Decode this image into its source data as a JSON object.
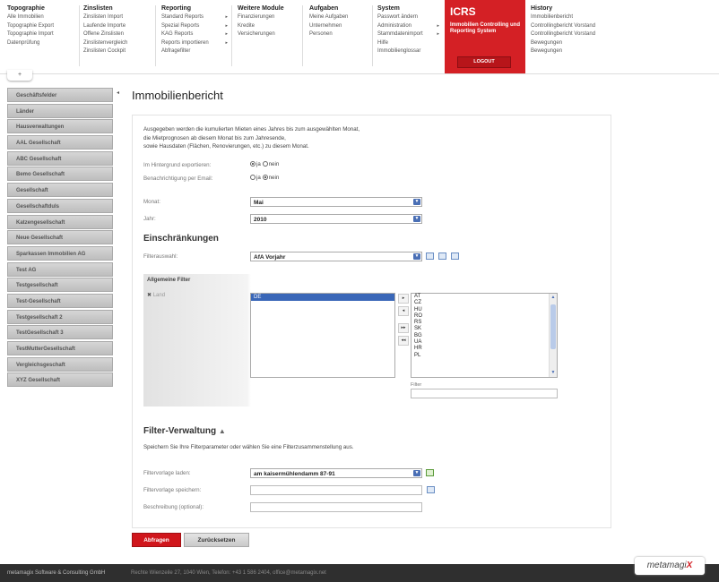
{
  "menu": [
    {
      "title": "Topographie",
      "items": [
        "Alle Immobilien",
        "Topographie Export",
        "Topographie Import",
        "Datenprüfung"
      ]
    },
    {
      "title": "Zinslisten",
      "items": [
        "Zinslisten Import",
        "Laufende Importe",
        "Offene Zinslisten",
        "Zinslistenvergleich",
        "Zinslisten Cockpit"
      ]
    },
    {
      "title": "Reporting",
      "items": [
        "Standard Reports",
        "Spezial Reports",
        "KAG Reports",
        "Reports importieren",
        "Abfragefilter"
      ]
    },
    {
      "title": "Weitere Module",
      "items": [
        "Finanzierungen",
        "Kredite",
        "Versicherungen"
      ]
    },
    {
      "title": "Aufgaben",
      "items": [
        "Meine Aufgaben",
        "Unternehmen",
        "Personen"
      ]
    },
    {
      "title": "System",
      "items": [
        "Passwort ändern",
        "Administration",
        "Stammdatenimport",
        "Hilfe",
        "Immobilienglossar"
      ]
    },
    {
      "title": "History",
      "items": [
        "Immobilienbericht",
        "Controllingbericht Vorstand",
        "Controllingbericht Vorstand",
        "Bewegungen",
        "Bewegungen"
      ]
    }
  ],
  "icrs": {
    "title": "ICRS",
    "subtitle": "Immobilien Controlling und Reporting System",
    "logout": "LOGOUT"
  },
  "toggle": "+",
  "sidebar": [
    "Geschäftsfelder",
    "Länder",
    "Hausverwaltungen",
    "AAL Gesellschaft",
    "ABC Gesellschaft",
    "Bemo Gesellschaft",
    "Gesellschaft",
    "Gesellschaftduls",
    "Katzengesellschaft",
    "Neue Gesellschaft",
    "Sparkassen Immobilien AG",
    "Test AG",
    "Testgesellschaft",
    "Test-Gesellschaft",
    "Testgesellschaft 2",
    "TestGesellschaft 3",
    "TestMutterGesellschaft",
    "Vergleichsgeschaft",
    "XYZ Gesellschaft"
  ],
  "page": {
    "title": "Immobilienbericht",
    "intro": [
      "Ausgegeben werden die kumulierten Mieten eines Jahres bis zum ausgewählten Monat,",
      "die Mietprognosen ab diesem Monat bis zum Jahresende,",
      "sowie Hausdaten (Flächen, Renovierungen, etc.) zu diesem Monat."
    ],
    "export_label": "Im Hintergrund exportieren:",
    "notify_label": "Benachrichtigung per Email:",
    "ja": "ja",
    "nein": "nein",
    "monat_label": "Monat:",
    "monat_value": "Mai",
    "jahr_label": "Jahr:",
    "jahr_value": "2010",
    "einschraenkungen": "Einschränkungen",
    "filterauswahl_label": "Filterauswahl:",
    "filterauswahl_value": "AfA Vorjahr",
    "allg_filter": "Allgemeine Filter",
    "land_label": "Land",
    "selected": [
      "DE"
    ],
    "available": [
      "AT",
      "CZ",
      "HU",
      "RO",
      "RS",
      "SK",
      "BG",
      "UA",
      "HR",
      "PL"
    ],
    "filter_label": "Filter",
    "filterverwaltung": "Filter-Verwaltung",
    "fv_text": "Speichern Sie Ihre Filterparameter oder wählen Sie eine Filterzusammenstellung aus.",
    "fv_laden_label": "Filtervorlage laden:",
    "fv_laden_value": "am kaisermühlendamm 87-91",
    "fv_speichern_label": "Filtervorlage speichern:",
    "beschreibung_label": "Beschreibung (optional):",
    "btn_abfragen": "Abfragen",
    "btn_reset": "Zurücksetzen"
  },
  "footer": {
    "company": "metamagix Software & Consulting GmbH",
    "address": "Rechte Wienzeile 27, 1040 Wien, Telefon: +43 1 586 2404, office@metamagix.net"
  },
  "logo": {
    "text": "metamagi",
    "x": "X"
  }
}
